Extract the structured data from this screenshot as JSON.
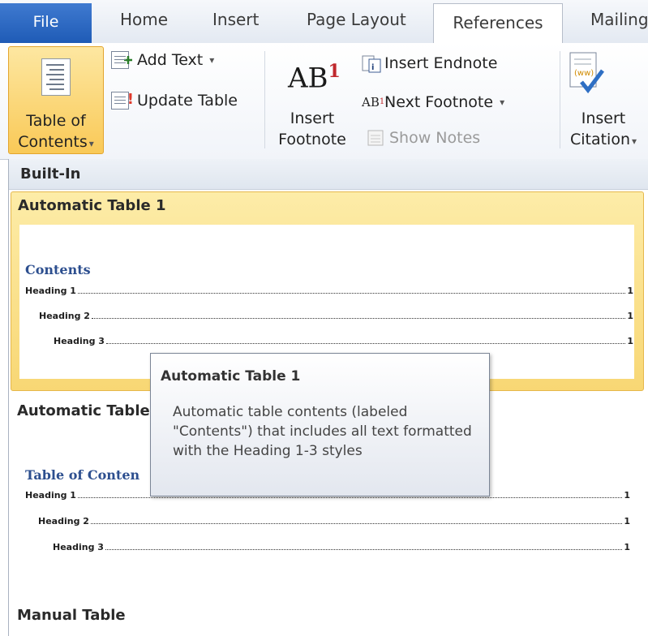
{
  "tabs": {
    "file": "File",
    "home": "Home",
    "insert": "Insert",
    "page_layout": "Page Layout",
    "references": "References",
    "mailings": "Mailing"
  },
  "ribbon": {
    "toc_line1": "Table of",
    "toc_line2": "Contents",
    "add_text": "Add Text",
    "update_table": "Update Table",
    "insert_footnote_line1": "Insert",
    "insert_footnote_line2": "Footnote",
    "ab_text": "AB",
    "ab_sup": "1",
    "insert_endnote": "Insert Endnote",
    "next_footnote": "Next Footnote",
    "show_notes": "Show Notes",
    "insert_citation_line1": "Insert",
    "insert_citation_line2": "Citation"
  },
  "gallery": {
    "section_builtin": "Built-In",
    "auto1": {
      "title": "Automatic Table 1",
      "heading": "Contents",
      "lines": [
        {
          "text": "Heading 1",
          "page": "1"
        },
        {
          "text": "Heading 2",
          "page": "1"
        },
        {
          "text": "Heading 3",
          "page": "1"
        }
      ]
    },
    "auto2": {
      "title": "Automatic Table",
      "heading": "Table of Conten",
      "lines": [
        {
          "text": "Heading 1",
          "page": "1"
        },
        {
          "text": "Heading 2",
          "page": "1"
        },
        {
          "text": "Heading 3",
          "page": "1"
        }
      ]
    },
    "manual_title": "Manual Table"
  },
  "tooltip": {
    "title": "Automatic Table 1",
    "body": "Automatic table contents (labeled \"Contents\") that includes all text formatted with the Heading 1-3 styles"
  },
  "colors": {
    "file_tab": "#2a65c2",
    "selected_item": "#f8d774",
    "toc_heading": "#2d4f8f"
  }
}
